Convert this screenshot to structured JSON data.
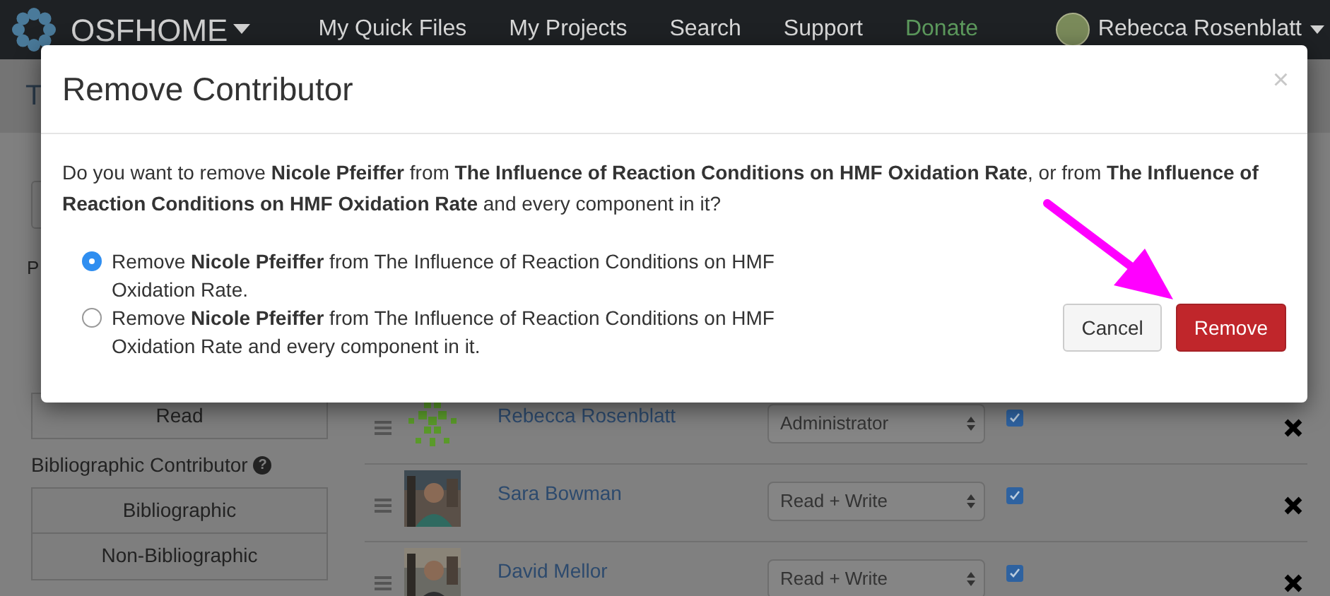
{
  "navbar": {
    "brand": "OSF**HOME**",
    "links": [
      "My Quick Files",
      "My Projects",
      "Search",
      "Support"
    ],
    "donate": "Donate",
    "user": "Rebecca Rosenblatt"
  },
  "project_header": {
    "title": "T"
  },
  "sidebar": {
    "section_label": "P",
    "permission_button": "Read",
    "bibliographic_label": "Bibliographic Contributor",
    "help_icon": "?",
    "bibliographic_buttons": [
      "Bibliographic",
      "Non-Bibliographic"
    ]
  },
  "contributors": [
    {
      "name": "Rebecca Rosenblatt",
      "avatar": {
        "kind": "identicon"
      },
      "permission": "Administrator",
      "bibliographic": true
    },
    {
      "name": "Sara Bowman",
      "permission": "Read + Write",
      "bibliographic": true
    },
    {
      "name": "David Mellor",
      "permission": "Read + Write",
      "bibliographic": true
    }
  ],
  "modal": {
    "title": "Remove Contributor",
    "close": "×",
    "message": "Do you want to remove **Nicole Pfeiffer** from **The Influence of Reaction Conditions on HMF Oxidation Rate**, or from **The Influence of Reaction Conditions on HMF Oxidation Rate** and every component in it?",
    "options": [
      {
        "label": "Remove **Nicole Pfeiffer** from The Influence of Reaction Conditions on HMF Oxidation Rate.",
        "selected": true
      },
      {
        "label": "Remove **Nicole Pfeiffer** from The Influence of Reaction Conditions on HMF Oxidation Rate and every component in it.",
        "selected": false
      }
    ],
    "buttons": [
      {
        "label": "Cancel",
        "kind": "default"
      },
      {
        "label": "Remove",
        "kind": "danger"
      }
    ]
  }
}
